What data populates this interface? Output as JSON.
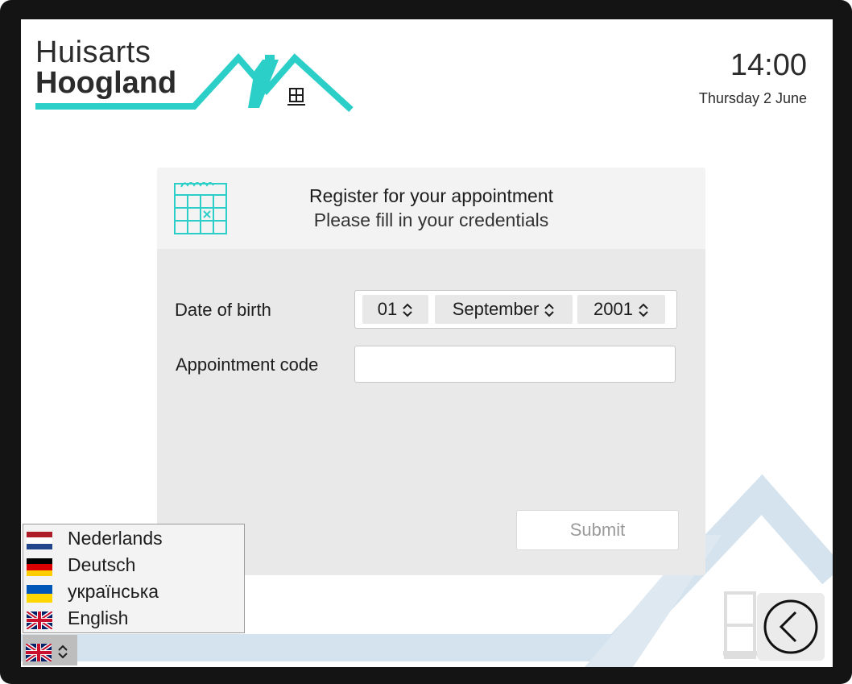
{
  "brand": {
    "name_line1": "Huisarts",
    "name_line2": "Hoogland",
    "accent_color": "#2ccfc8",
    "bg_house_color": "#d4e3ee"
  },
  "clock": {
    "time": "14:00",
    "date": "Thursday 2 June"
  },
  "form": {
    "title": "Register for your appointment",
    "subtitle": "Please fill in your credentials",
    "dob_label": "Date of birth",
    "dob_day": "01",
    "dob_month": "September",
    "dob_year": "2001",
    "code_label": "Appointment code",
    "code_value": "",
    "submit_label": "Submit"
  },
  "language": {
    "options": [
      {
        "label": "Nederlands",
        "flag": "nl-flag-icon"
      },
      {
        "label": "Deutsch",
        "flag": "de-flag-icon"
      },
      {
        "label": "українська",
        "flag": "ua-flag-icon"
      },
      {
        "label": "English",
        "flag": "uk-flag-icon"
      }
    ],
    "selected_flag": "uk-flag-icon"
  },
  "icons": {
    "calendar": "calendar-icon",
    "back": "back-arrow-icon",
    "window": "window-icon"
  }
}
